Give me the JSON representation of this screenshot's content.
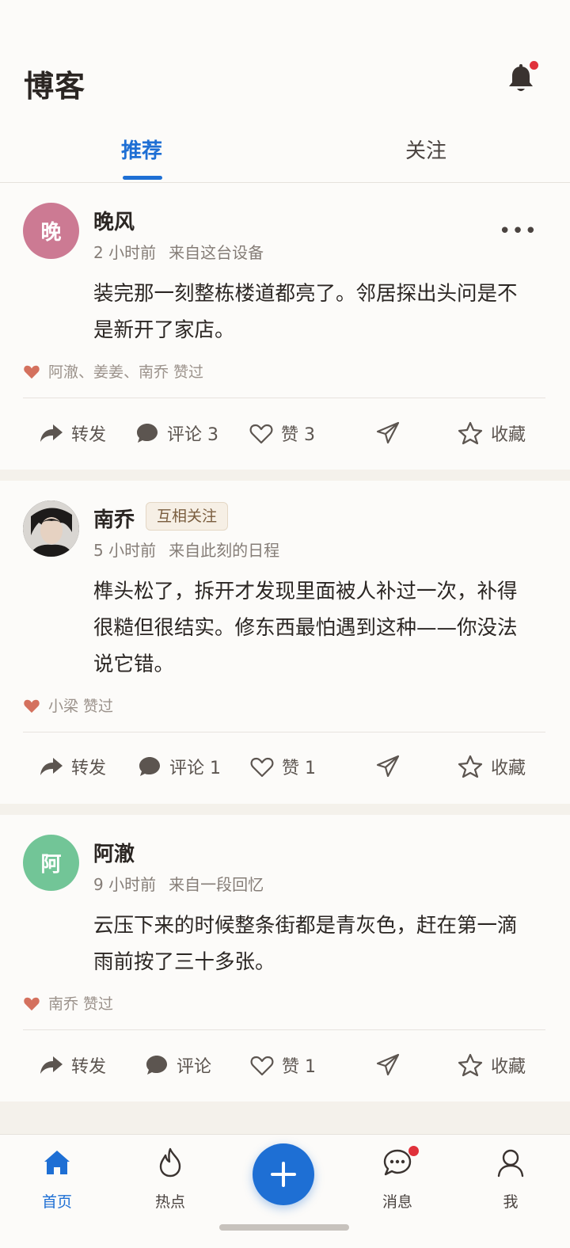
{
  "header": {
    "title": "博客",
    "tabs": [
      {
        "label": "推荐",
        "active": true
      },
      {
        "label": "关注",
        "active": false
      }
    ]
  },
  "posts": [
    {
      "author": "晚风",
      "avatar_text": "晚",
      "avatar_color": "#cc7a93",
      "badge": "",
      "time": "2 小时前",
      "source": "来自这台设备",
      "content": "装完那一刻整栋楼道都亮了。邻居探出头问是不是新开了家店。",
      "liked_by": "阿澈、姜姜、南乔 赞过",
      "actions": {
        "repost": "转发",
        "comment": "评论 3",
        "like": "赞 3",
        "favorite": "收藏"
      }
    },
    {
      "author": "南乔",
      "avatar_text": "",
      "avatar_color": "#2a2a2a",
      "badge": "互相关注",
      "time": "5 小时前",
      "source": "来自此刻的日程",
      "content": "榫头松了，拆开才发现里面被人补过一次，补得很糙但很结实。修东西最怕遇到这种——你没法说它错。",
      "liked_by": "小梁 赞过",
      "actions": {
        "repost": "转发",
        "comment": "评论 1",
        "like": "赞 1",
        "favorite": "收藏"
      }
    },
    {
      "author": "阿澈",
      "avatar_text": "阿",
      "avatar_color": "#72c597",
      "badge": "",
      "time": "9 小时前",
      "source": "来自一段回忆",
      "content": "云压下来的时候整条街都是青灰色，赶在第一滴雨前按了三十多张。",
      "liked_by": "南乔 赞过",
      "actions": {
        "repost": "转发",
        "comment": "评论",
        "like": "赞 1",
        "favorite": "收藏"
      }
    }
  ],
  "bottom_nav": {
    "items": [
      {
        "label": "首页",
        "icon": "home-icon",
        "active": true
      },
      {
        "label": "热点",
        "icon": "flame-icon",
        "active": false
      },
      {
        "label": "",
        "icon": "plus-icon",
        "active": false
      },
      {
        "label": "消息",
        "icon": "message-icon",
        "active": false,
        "badge": true
      },
      {
        "label": "我",
        "icon": "user-icon",
        "active": false
      }
    ]
  },
  "colors": {
    "accent": "#1e6fd4",
    "notification_dot": "#e0313b",
    "like_heart": "#d4715e",
    "background": "#f4f1eb",
    "card": "#fcfbf9"
  }
}
